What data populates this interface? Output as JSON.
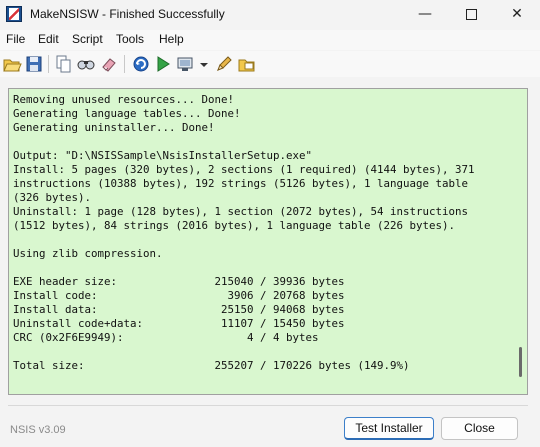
{
  "window": {
    "title": "MakeNSISW - Finished Successfully",
    "controls": {
      "minimize": "—",
      "close": "✕"
    }
  },
  "menu": [
    "File",
    "Edit",
    "Script",
    "Tools",
    "Help"
  ],
  "toolbar_icons": [
    "open-folder-icon",
    "save-icon",
    "copy-icon",
    "find-icon",
    "clear-icon",
    "recompile-icon",
    "test-run-icon",
    "compressor-icon",
    "dropdown-arrow-icon",
    "edit-script-icon",
    "browse-script-icon"
  ],
  "output": {
    "lines": [
      "Removing unused resources... Done!",
      "Generating language tables... Done!",
      "Generating uninstaller... Done!",
      "",
      "Output: \"D:\\NSISSample\\NsisInstallerSetup.exe\"",
      "Install: 5 pages (320 bytes), 2 sections (1 required) (4144 bytes), 371",
      "instructions (10388 bytes), 192 strings (5126 bytes), 1 language table",
      "(326 bytes).",
      "Uninstall: 1 page (128 bytes), 1 section (2072 bytes), 54 instructions",
      "(1512 bytes), 84 strings (2016 bytes), 1 language table (226 bytes).",
      "",
      "Using zlib compression.",
      "",
      "EXE header size:               215040 / 39936 bytes",
      "Install code:                    3906 / 20768 bytes",
      "Install data:                   25150 / 94068 bytes",
      "Uninstall code+data:            11107 / 15450 bytes",
      "CRC (0x2F6E9949):                   4 / 4 bytes",
      "",
      "Total size:                    255207 / 170226 bytes (149.9%)"
    ],
    "background": "#d9f7cf"
  },
  "footer": {
    "version": "NSIS v3.09",
    "test_button": "Test Installer",
    "close_button": "Close"
  }
}
